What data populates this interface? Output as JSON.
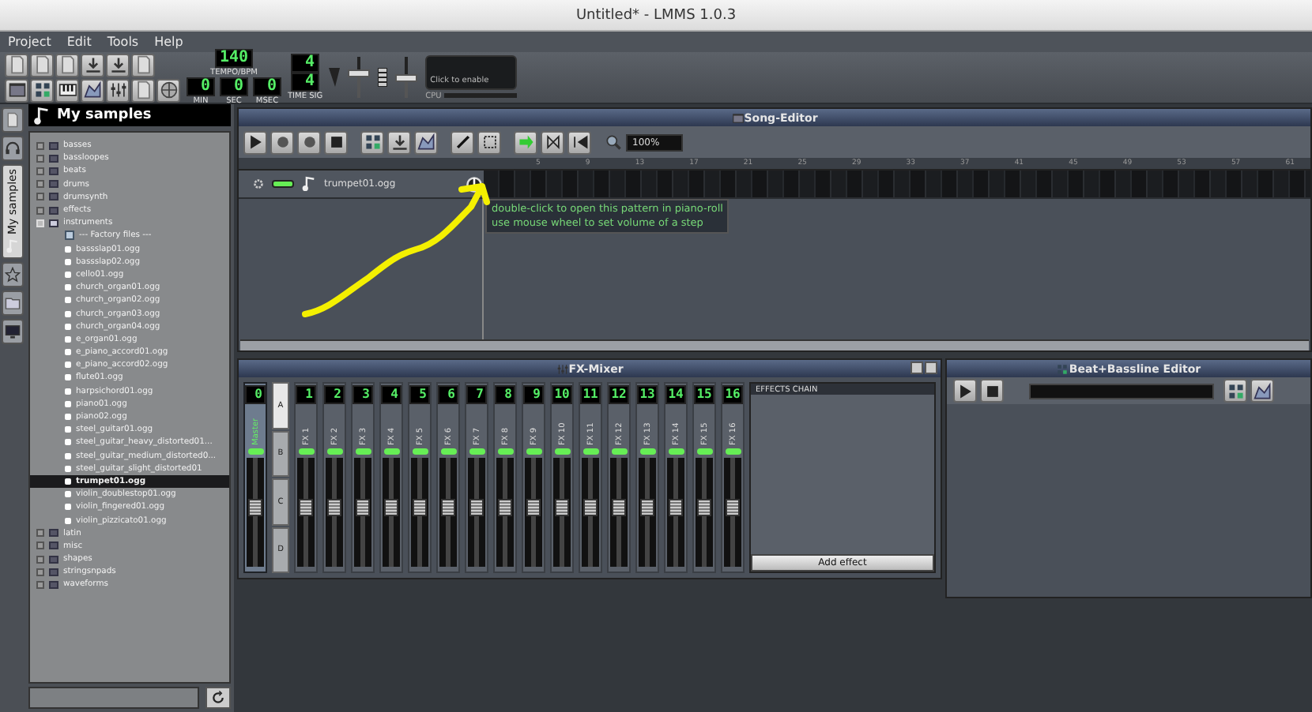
{
  "window": {
    "title": "Untitled* - LMMS 1.0.3"
  },
  "menu": [
    "Project",
    "Edit",
    "Tools",
    "Help"
  ],
  "transport": {
    "tempo": "140",
    "tempo_label": "TEMPO/BPM",
    "min": "0",
    "min_label": "MIN",
    "sec": "0",
    "sec_label": "SEC",
    "msec": "0",
    "msec_label": "MSEC",
    "sig_num": "4",
    "sig_den": "4",
    "sig_label": "TIME SIG",
    "cpu_hint": "Click to enable",
    "cpu_label": "CPU",
    "volume": {
      "level": 0.6
    },
    "pitch": {
      "level": 0.5
    }
  },
  "sidebar": {
    "tabs": [
      {
        "kind": "instruments",
        "selected": false
      },
      {
        "kind": "presets",
        "selected": false
      },
      {
        "kind": "samples",
        "label": "My samples",
        "selected": true
      },
      {
        "kind": "favorites",
        "selected": false
      },
      {
        "kind": "folder",
        "selected": false
      },
      {
        "kind": "computer",
        "selected": false
      }
    ],
    "title": "My samples",
    "tree": [
      {
        "label": "basses",
        "kind": "folder",
        "expanded": false,
        "selected": false
      },
      {
        "label": "bassloopes",
        "kind": "folder",
        "expanded": false,
        "selected": false
      },
      {
        "label": "beats",
        "kind": "folder",
        "expanded": false,
        "selected": false
      },
      {
        "label": "drums",
        "kind": "folder",
        "expanded": false,
        "selected": false
      },
      {
        "label": "drumsynth",
        "kind": "folder",
        "expanded": false,
        "selected": false
      },
      {
        "label": "effects",
        "kind": "folder",
        "expanded": false,
        "selected": false
      },
      {
        "label": "instruments",
        "kind": "folder",
        "expanded": true,
        "selected": false,
        "children": [
          {
            "label": "--- Factory files ---",
            "kind": "header",
            "selected": false
          },
          {
            "label": "bassslap01.ogg",
            "kind": "file",
            "selected": false
          },
          {
            "label": "bassslap02.ogg",
            "kind": "file",
            "selected": false
          },
          {
            "label": "cello01.ogg",
            "kind": "file",
            "selected": false
          },
          {
            "label": "church_organ01.ogg",
            "kind": "file",
            "selected": false
          },
          {
            "label": "church_organ02.ogg",
            "kind": "file",
            "selected": false
          },
          {
            "label": "church_organ03.ogg",
            "kind": "file",
            "selected": false
          },
          {
            "label": "church_organ04.ogg",
            "kind": "file",
            "selected": false
          },
          {
            "label": "e_organ01.ogg",
            "kind": "file",
            "selected": false
          },
          {
            "label": "e_piano_accord01.ogg",
            "kind": "file",
            "selected": false
          },
          {
            "label": "e_piano_accord02.ogg",
            "kind": "file",
            "selected": false
          },
          {
            "label": "flute01.ogg",
            "kind": "file",
            "selected": false
          },
          {
            "label": "harpsichord01.ogg",
            "kind": "file",
            "selected": false
          },
          {
            "label": "piano01.ogg",
            "kind": "file",
            "selected": false
          },
          {
            "label": "piano02.ogg",
            "kind": "file",
            "selected": false
          },
          {
            "label": "steel_guitar01.ogg",
            "kind": "file",
            "selected": false
          },
          {
            "label": "steel_guitar_heavy_distorted01...",
            "kind": "file",
            "selected": false
          },
          {
            "label": "steel_guitar_medium_distorted0...",
            "kind": "file",
            "selected": false
          },
          {
            "label": "steel_guitar_slight_distorted01",
            "kind": "file",
            "selected": false
          },
          {
            "label": "trumpet01.ogg",
            "kind": "file",
            "selected": true
          },
          {
            "label": "violin_doublestop01.ogg",
            "kind": "file",
            "selected": false
          },
          {
            "label": "violin_fingered01.ogg",
            "kind": "file",
            "selected": false
          },
          {
            "label": "violin_pizzicato01.ogg",
            "kind": "file",
            "selected": false
          }
        ]
      },
      {
        "label": "latin",
        "kind": "folder",
        "expanded": false,
        "selected": false
      },
      {
        "label": "misc",
        "kind": "folder",
        "expanded": false,
        "selected": false
      },
      {
        "label": "shapes",
        "kind": "folder",
        "expanded": false,
        "selected": false
      },
      {
        "label": "stringsnpads",
        "kind": "folder",
        "expanded": false,
        "selected": false
      },
      {
        "label": "waveforms",
        "kind": "folder",
        "expanded": false,
        "selected": false
      }
    ]
  },
  "song_editor": {
    "title": "Song-Editor",
    "zoom": "100%",
    "ruler": [
      "5",
      "9",
      "13",
      "17",
      "21",
      "25",
      "29",
      "33",
      "37",
      "41",
      "45",
      "49",
      "53",
      "57",
      "61"
    ],
    "track": {
      "name": "trumpet01.ogg",
      "muted": false
    },
    "tooltip": [
      "double-click to open this pattern in piano-roll",
      "use mouse wheel to set volume of a step"
    ]
  },
  "fx_mixer": {
    "title": "FX-Mixer",
    "buses": [
      {
        "label": "A",
        "selected": true
      },
      {
        "label": "B",
        "selected": false
      },
      {
        "label": "C",
        "selected": false
      },
      {
        "label": "D",
        "selected": false
      }
    ],
    "channels": [
      {
        "number": "0",
        "name": "Master",
        "selected": true,
        "level": 0.55
      },
      {
        "number": "1",
        "name": "FX 1",
        "selected": false,
        "level": 0.55
      },
      {
        "number": "2",
        "name": "FX 2",
        "selected": false,
        "level": 0.55
      },
      {
        "number": "3",
        "name": "FX 3",
        "selected": false,
        "level": 0.55
      },
      {
        "number": "4",
        "name": "FX 4",
        "selected": false,
        "level": 0.55
      },
      {
        "number": "5",
        "name": "FX 5",
        "selected": false,
        "level": 0.55
      },
      {
        "number": "6",
        "name": "FX 6",
        "selected": false,
        "level": 0.55
      },
      {
        "number": "7",
        "name": "FX 7",
        "selected": false,
        "level": 0.55
      },
      {
        "number": "8",
        "name": "FX 8",
        "selected": false,
        "level": 0.55
      },
      {
        "number": "9",
        "name": "FX 9",
        "selected": false,
        "level": 0.55
      },
      {
        "number": "10",
        "name": "FX 10",
        "selected": false,
        "level": 0.55
      },
      {
        "number": "11",
        "name": "FX 11",
        "selected": false,
        "level": 0.55
      },
      {
        "number": "12",
        "name": "FX 12",
        "selected": false,
        "level": 0.55
      },
      {
        "number": "13",
        "name": "FX 13",
        "selected": false,
        "level": 0.55
      },
      {
        "number": "14",
        "name": "FX 14",
        "selected": false,
        "level": 0.55
      },
      {
        "number": "15",
        "name": "FX 15",
        "selected": false,
        "level": 0.55
      },
      {
        "number": "16",
        "name": "FX 16",
        "selected": false,
        "level": 0.55
      }
    ],
    "effects_chain": {
      "title": "EFFECTS CHAIN",
      "button": "Add effect"
    }
  },
  "bb_editor": {
    "title": "Beat+Bassline Editor"
  }
}
